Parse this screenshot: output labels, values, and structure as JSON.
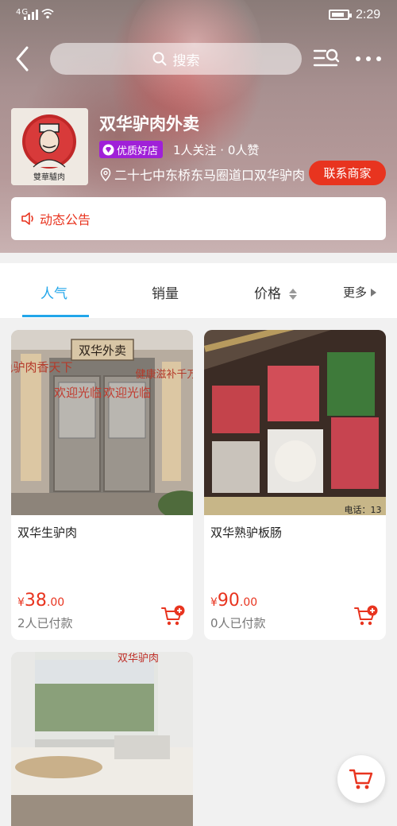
{
  "status_bar": {
    "network": "4G",
    "time": "2:29"
  },
  "nav": {
    "search_placeholder": "搜索"
  },
  "store": {
    "name": "双华驴肉外卖",
    "logo_text": "雙華驢肉",
    "badge": "优质好店",
    "stats": "1人关注 · 0人赞",
    "address": "二十七中东桥东马圈道口双华驴肉",
    "contact_label": "联系商家",
    "notice_label": "动态公告"
  },
  "tabs": [
    {
      "label": "人气",
      "active": true
    },
    {
      "label": "销量",
      "active": false
    },
    {
      "label": "价格",
      "active": false
    },
    {
      "label": "更多",
      "active": false
    }
  ],
  "products": [
    {
      "title": "双华生驴肉",
      "currency": "¥",
      "price_int": "38",
      "price_dec": ".00",
      "paid": "2人已付款",
      "img_text": {
        "sign": "双华外卖",
        "left": "绿色驴肉香天下",
        "right": "健康滋补千万家",
        "door_left": "欢迎光临",
        "door_right": "欢迎光临"
      }
    },
    {
      "title": "双华熟驴板肠",
      "currency": "¥",
      "price_int": "90",
      "price_dec": ".00",
      "paid": "0人已付款",
      "img_text": {
        "phone": "电话：13"
      }
    },
    {
      "title": "",
      "img_text": {
        "banner": "双华驴肉"
      }
    }
  ],
  "colors": {
    "accent": "#22a6ea",
    "price": "#e8341f",
    "badge": "#a020d8"
  }
}
